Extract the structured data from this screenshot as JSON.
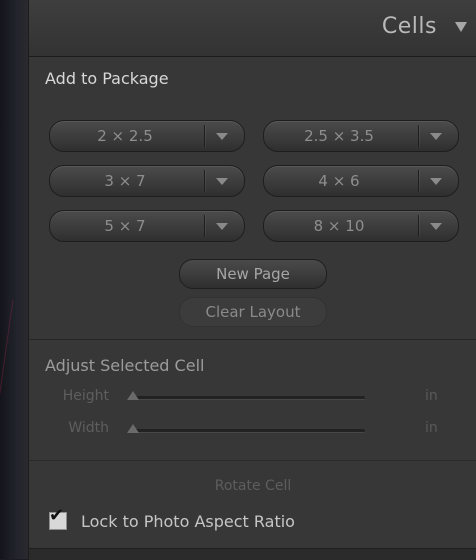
{
  "panel": {
    "title": "Cells",
    "collapse_icon": "triangle-down-icon"
  },
  "add_to_package": {
    "heading": "Add to Package",
    "sizes": [
      "2 × 2.5",
      "2.5 × 3.5",
      "3 × 7",
      "4 × 6",
      "5 × 7",
      "8 × 10"
    ],
    "new_page": "New Page",
    "clear_layout": "Clear Layout"
  },
  "adjust_cell": {
    "heading": "Adjust Selected Cell",
    "height_label": "Height",
    "width_label": "Width",
    "height_unit": "in",
    "width_unit": "in",
    "height_value": 0,
    "width_value": 0,
    "rotate_label": "Rotate Cell"
  },
  "lock_aspect": {
    "label": "Lock to Photo Aspect Ratio",
    "checked": true
  }
}
